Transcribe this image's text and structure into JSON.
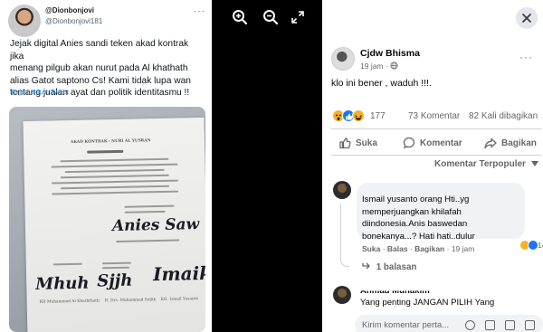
{
  "tweet": {
    "username": "@Dionbonjovi",
    "handle": "@Dionbonjovi181",
    "more": "···",
    "text_lines": [
      "Jejak digital Anies sandi teken akad kontrak jika",
      "menang pilgub akan nurut pada Al khathath",
      "alias Gatot saptono Cs! Kami tidak lupa wan",
      "tentang jualan ayat dan politik identitasmu !!"
    ],
    "translate": "Terjemahkan Tweet",
    "document": {
      "heading": "AKAD KONTRAK : NURI AL YUSRAN",
      "signers": [
        "KH Muhammad Al Khaththath",
        "H. Drs. Muhammad Sallik",
        "KH. Ismail Yusanto"
      ]
    }
  },
  "viewer": {
    "icons": [
      "zoom-in-icon",
      "zoom-out-icon",
      "fullscreen-icon"
    ]
  },
  "post": {
    "author": "Cjdw Bhisma",
    "time": "19 jam",
    "privacy_icon": "globe-icon",
    "more": "···",
    "text": "klo ini bener , waduh !!!.",
    "reactions": {
      "count": "177",
      "types": [
        "wow",
        "like",
        "haha"
      ]
    },
    "comments_count": "73 Komentar",
    "shares_count": "82 Kali dibagikan",
    "actions": {
      "like": "Suka",
      "comment": "Komentar",
      "share": "Bagikan"
    },
    "sort_label": "Komentar Terpopuler",
    "comment": {
      "author": "Ismail yusanto orang Hti..yg",
      "lines": [
        "Ismail yusanto orang Hti..yg",
        "memperjuangkan khilafah",
        "diindonesia.Anis baswedan",
        "bonekanya...? Hati hati..dulur"
      ],
      "like": "Suka",
      "reply": "Balas",
      "share": "Bagikan",
      "time": "19 jam",
      "reaction_count": "14",
      "replies": "1 balasan"
    },
    "comment2": {
      "author": "Ahmad Muhakim",
      "text": "Yang penting JANGAN PILIH Yang"
    },
    "composer_placeholder": "Kirim komentar perta..."
  },
  "colors": {
    "fb_text": "#050505",
    "fb_muted": "#65676b",
    "twitter_blue": "#1d9bf0",
    "like_blue": "#1877f2",
    "reaction_yellow": "#f7b125"
  }
}
